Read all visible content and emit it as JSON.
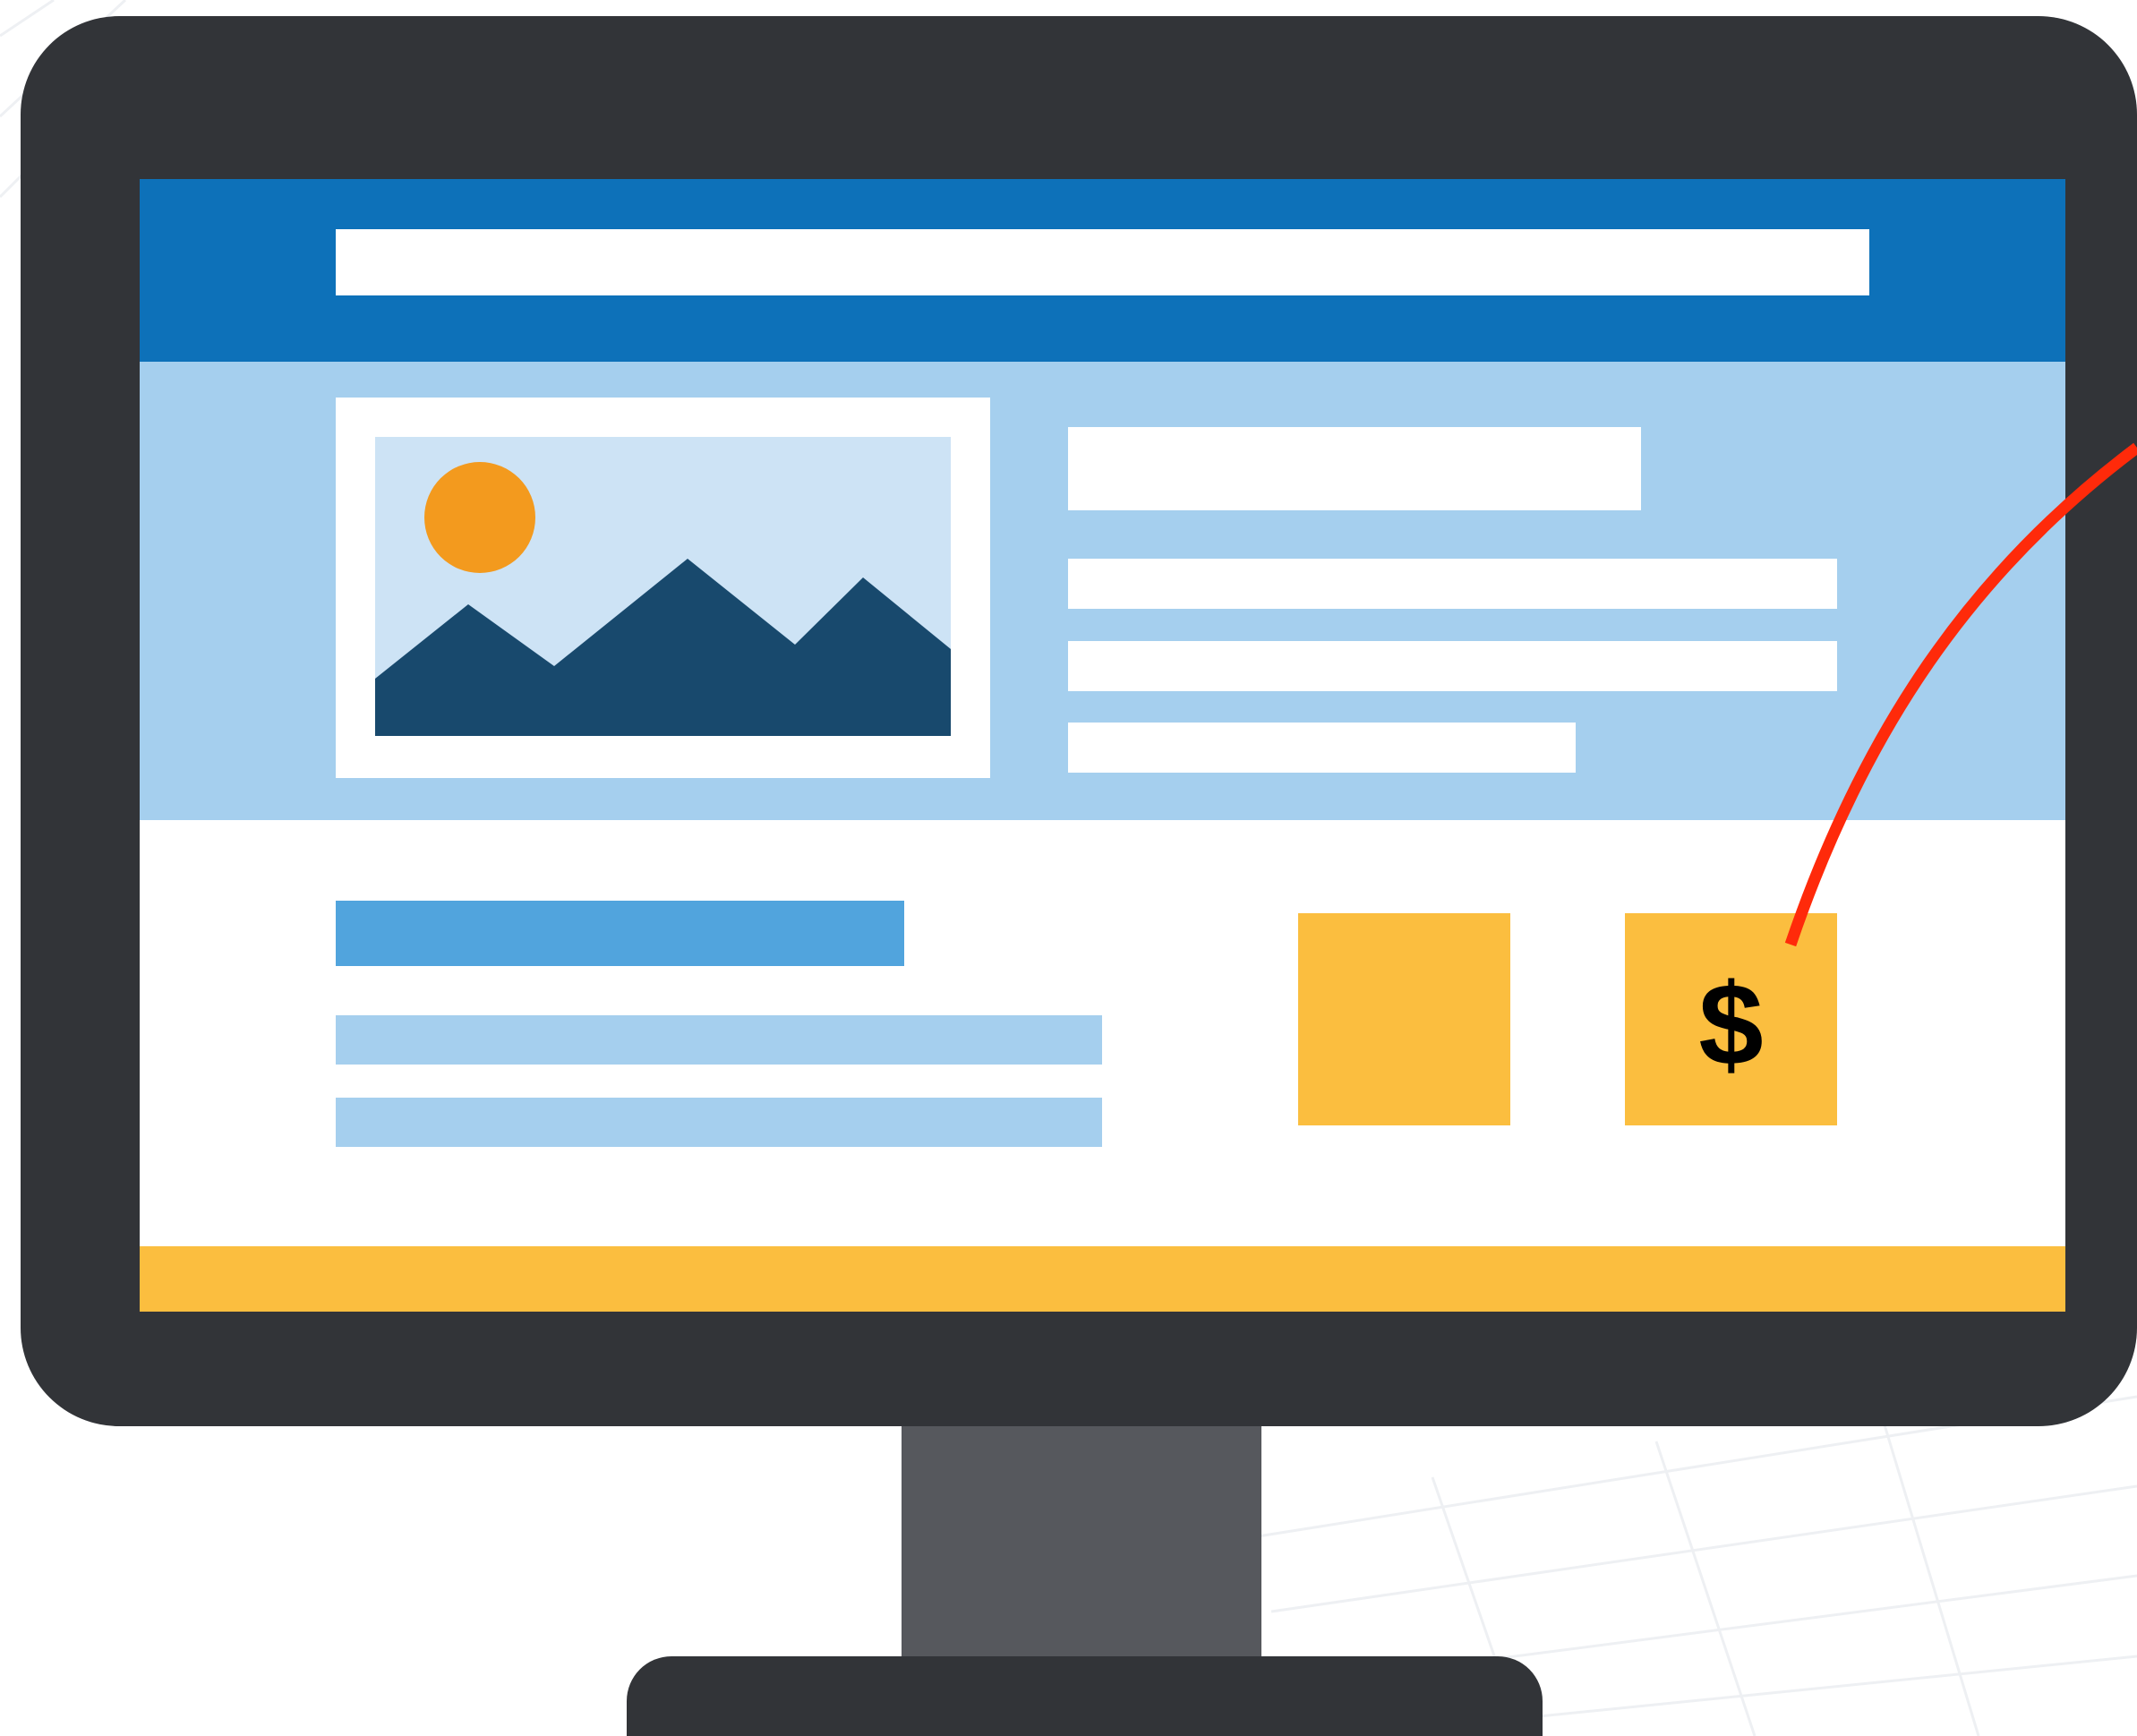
{
  "illustration": {
    "subject": "computer-monitor-showing-webpage",
    "colors": {
      "bezel": "#323438",
      "stand_neck": "#56585d",
      "header": "#0d71b9",
      "hero_background": "#a5cfee",
      "heading_block": "#51a4dd",
      "accent_yellow": "#fbbe3f",
      "sun": "#f39a1e",
      "mountains": "#18496d",
      "sky": "#cde3f5",
      "annotation_line": "#ff2a0a"
    }
  },
  "content_tiles": {
    "price_tile_symbol": "$"
  },
  "icons": {
    "hero_image": "image-placeholder-icon",
    "annotation": "pointer-line"
  }
}
